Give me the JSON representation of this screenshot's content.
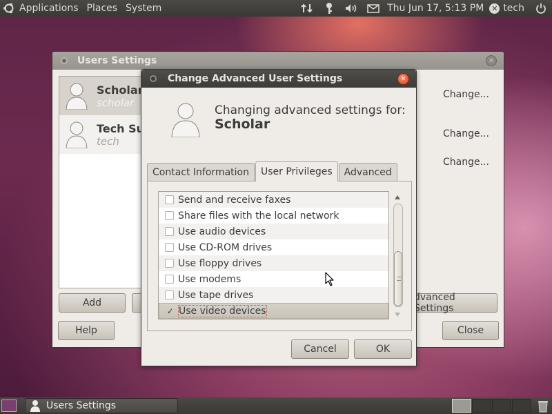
{
  "top_panel": {
    "menus": [
      "Applications",
      "Places",
      "System"
    ],
    "datetime": "Thu Jun 17,  5:13 PM",
    "user": "tech"
  },
  "users_window": {
    "title": "Users Settings",
    "users": [
      {
        "name": "Scholar",
        "login": "scholar"
      },
      {
        "name": "Tech Su",
        "login": "tech"
      }
    ],
    "change_links": [
      "Change...",
      "Change...",
      "Change..."
    ],
    "add_label": "Add",
    "advanced_settings_label": "dvanced Settings",
    "help_label": "Help",
    "close_label": "Close"
  },
  "advanced_dialog": {
    "title": "Change Advanced User Settings",
    "heading": "Changing advanced settings for:",
    "user": "Scholar",
    "tabs": [
      "Contact Information",
      "User Privileges",
      "Advanced"
    ],
    "active_tab": "User Privileges",
    "privileges": [
      {
        "label": "Send and receive faxes",
        "checked": false
      },
      {
        "label": "Share files with the local network",
        "checked": false
      },
      {
        "label": "Use audio devices",
        "checked": false
      },
      {
        "label": "Use CD-ROM drives",
        "checked": false
      },
      {
        "label": "Use floppy drives",
        "checked": false
      },
      {
        "label": "Use modems",
        "checked": false
      },
      {
        "label": "Use tape drives",
        "checked": false
      },
      {
        "label": "Use video devices",
        "checked": true
      }
    ],
    "cancel_label": "Cancel",
    "ok_label": "OK"
  },
  "bottom_panel": {
    "task_label": "Users Settings"
  }
}
